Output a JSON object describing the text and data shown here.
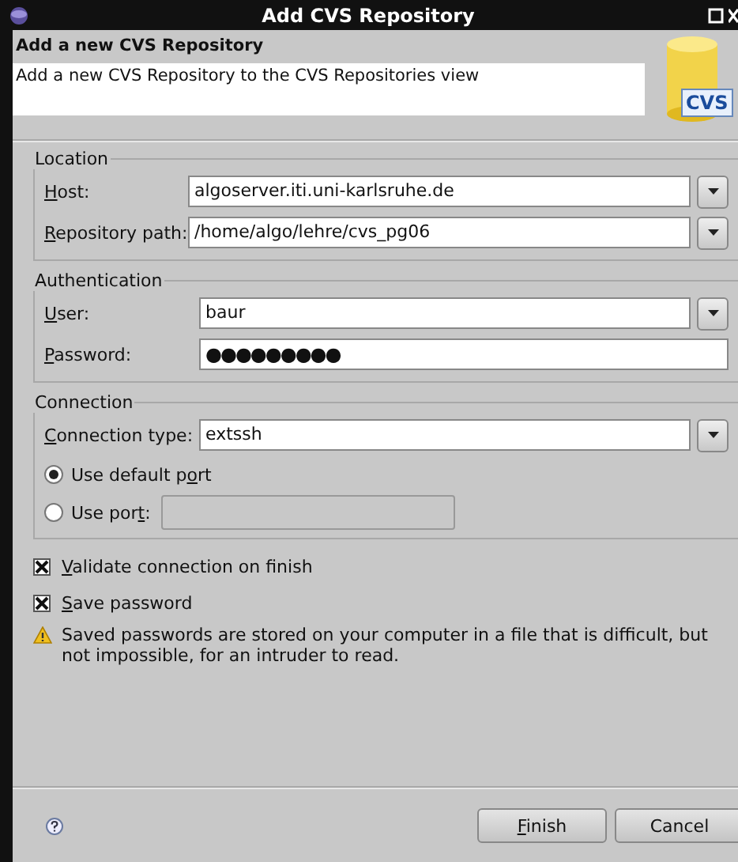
{
  "window": {
    "title": "Add CVS Repository"
  },
  "header": {
    "title": "Add a new CVS Repository",
    "description": "Add a new CVS Repository to the CVS Repositories view",
    "logo_text": "CVS"
  },
  "groups": [
    {
      "title": "Location",
      "rows": [
        {
          "kind": "combo",
          "before": "",
          "key": "H",
          "after": "ost:",
          "value": "algoserver.iti.uni-karlsruhe.de"
        },
        {
          "kind": "combo",
          "before": "",
          "key": "R",
          "after": "epository path:",
          "value": "/home/algo/lehre/cvs_pg06"
        }
      ]
    },
    {
      "title": "Authentication",
      "rows": [
        {
          "kind": "combo",
          "before": "",
          "key": "U",
          "after": "ser:",
          "value": "baur"
        },
        {
          "kind": "password",
          "before": "",
          "key": "P",
          "after": "assword:",
          "value": "●●●●●●●●●"
        }
      ]
    },
    {
      "title": "Connection",
      "rows": [
        {
          "kind": "combo",
          "before": "",
          "key": "C",
          "after": "onnection type:",
          "value": "extssh"
        },
        {
          "kind": "radio",
          "before": "Use default p",
          "key": "o",
          "after": "rt",
          "selected": true
        },
        {
          "kind": "radio_field",
          "before": "Use por",
          "key": "t",
          "after": ":",
          "selected": false,
          "disabled": true
        }
      ]
    }
  ],
  "checkboxes": [
    {
      "key": "V",
      "after": "alidate connection on finish",
      "checked": true
    },
    {
      "key": "S",
      "after": "ave password",
      "checked": true
    }
  ],
  "warning": "Saved passwords are stored on your computer in a file that is difficult, but not impossible, for an intruder to read.",
  "buttons": [
    {
      "key": "F",
      "after": "inish"
    },
    {
      "after": "Cancel"
    }
  ]
}
